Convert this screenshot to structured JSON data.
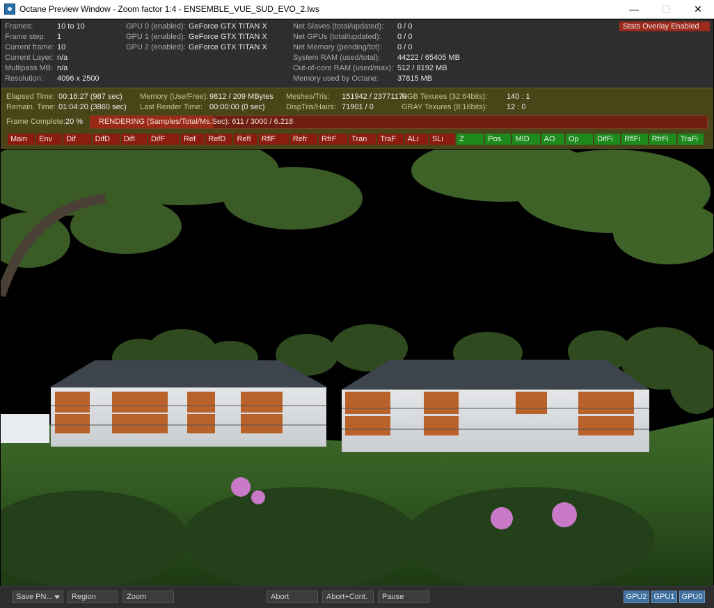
{
  "window": {
    "title": "Octane Preview Window - Zoom factor 1:4 - ENSEMBLE_VUE_SUD_EVO_2.lws",
    "icon": "octane-app-icon",
    "minimize": "—",
    "maximize": "☐",
    "close": "✕"
  },
  "stats": {
    "col1": [
      {
        "label": "Frames:",
        "value": "10 to 10"
      },
      {
        "label": "Frame step:",
        "value": "1"
      },
      {
        "label": "Current frame:",
        "value": "10"
      },
      {
        "label": "Current Layer:",
        "value": "n/a"
      },
      {
        "label": "Multipass MB:",
        "value": "n/a"
      },
      {
        "label": "Resolution:",
        "value": "4096 x 2500"
      }
    ],
    "gpus": [
      {
        "label": "GPU  0 (enabled):",
        "value": "GeForce GTX TITAN X"
      },
      {
        "label": "GPU  1 (enabled):",
        "value": "GeForce GTX TITAN X"
      },
      {
        "label": "GPU  2 (enabled):",
        "value": "GeForce GTX TITAN X"
      }
    ],
    "col3": [
      {
        "label": "Net Slaves (total/updated):",
        "value": "0 / 0"
      },
      {
        "label": "Net GPUs (total/updated):",
        "value": "0 / 0"
      },
      {
        "label": "Net Memory (pending/tot):",
        "value": "0 / 0"
      },
      {
        "label": "System RAM (used/total):",
        "value": "44222 / 65405 MB"
      },
      {
        "label": "Out-of-core RAM (used/max):",
        "value": "512 / 8192 MB"
      },
      {
        "label": "Memory used by Octane:",
        "value": "37815 MB"
      }
    ],
    "overlay_badge": "Stats Overlay Enabled"
  },
  "render": {
    "elapsed_label": "Elapsed Time:",
    "elapsed_value": "00:16:27 (987 sec)",
    "remain_label": "Remain. Time:",
    "remain_value": "01:04:20 (3860 sec)",
    "memory_label": "Memory (Use/Free):",
    "memory_value": "9812 / 209 MBytes",
    "last_label": "Last Render Time:",
    "last_value": "00:00:00 (0 sec)",
    "meshes_label": "Meshes/Tris:",
    "meshes_value": "151942 / 23771170",
    "disp_label": "DispTris/Hairs:",
    "disp_value": "71901 / 0",
    "rgb_label": "RGB Texures (32:64bits):",
    "rgb_value": "140 : 1",
    "gray_label": "GRAY Texures (8:16bits):",
    "gray_value": "12 : 0",
    "frame_complete_label": "Frame Complete:",
    "frame_complete_value": "20 %",
    "progress_fraction": 0.2,
    "status_text": "RENDERING (Samples/Total/Ms.Sec): 611 / 3000 / 6.218"
  },
  "passes": [
    {
      "label": "Main",
      "state": "red"
    },
    {
      "label": "Env",
      "state": "red"
    },
    {
      "label": "Dif",
      "state": "red"
    },
    {
      "label": "DifD",
      "state": "red"
    },
    {
      "label": "DifI",
      "state": "red"
    },
    {
      "label": "DifF",
      "state": "red"
    },
    {
      "label": "Ref",
      "state": "red"
    },
    {
      "label": "RefD",
      "state": "red"
    },
    {
      "label": "RefI",
      "state": "red"
    },
    {
      "label": "RflF",
      "state": "red"
    },
    {
      "label": "Refr",
      "state": "red"
    },
    {
      "label": "RfrF",
      "state": "red"
    },
    {
      "label": "Tran",
      "state": "red"
    },
    {
      "label": "TraF",
      "state": "red"
    },
    {
      "label": "ALi",
      "state": "red"
    },
    {
      "label": "SLi",
      "state": "red"
    },
    {
      "label": "Z",
      "state": "green"
    },
    {
      "label": "Pos",
      "state": "green"
    },
    {
      "label": "MID",
      "state": "green"
    },
    {
      "label": "AO",
      "state": "green"
    },
    {
      "label": "Op",
      "state": "green"
    },
    {
      "label": "DifFi",
      "state": "green"
    },
    {
      "label": "RflFi",
      "state": "green"
    },
    {
      "label": "RfrFi",
      "state": "green"
    },
    {
      "label": "TraFi",
      "state": "green"
    }
  ],
  "toolbar": {
    "save_label": "Save PN...",
    "region_label": "Region",
    "zoom_label": "Zoom",
    "abort_label": "Abort",
    "abort_cont_label": "Abort+Cont.",
    "pause_label": "Pause",
    "gpu_buttons": [
      "GPU2",
      "GPU1",
      "GPU0"
    ]
  },
  "colors": {
    "stats_bg": "#2e2e2e",
    "render_panel_bg": "#4a4419",
    "pass_red": "#8a1c10",
    "pass_green": "#1e8a1e",
    "gpu_button": "#3f6f9e"
  }
}
